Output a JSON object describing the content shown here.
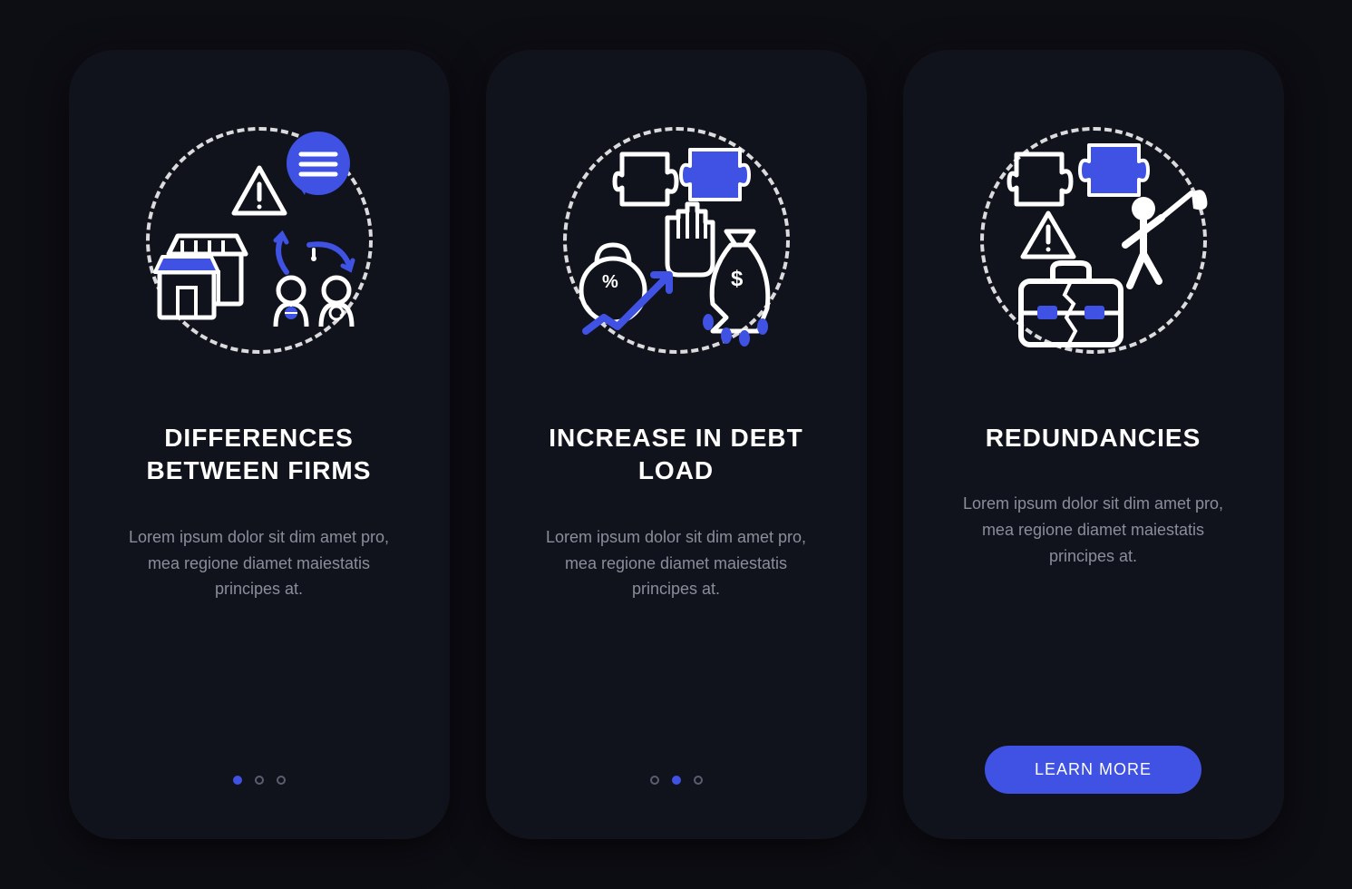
{
  "colors": {
    "accent": "#3f52e3",
    "background": "#0d0d14",
    "card": "#11131c",
    "text_primary": "#ffffff",
    "text_secondary": "#8a8e9a"
  },
  "cards": [
    {
      "icon_name": "firms-difference-icon",
      "heading": "DIFFERENCES BETWEEN FIRMS",
      "body": "Lorem ipsum dolor sit dim amet pro, mea regione diamet maiestatis principes at.",
      "footer_type": "dots",
      "active_dot": 0
    },
    {
      "icon_name": "debt-load-icon",
      "heading": "INCREASE IN DEBT LOAD",
      "body": "Lorem ipsum dolor sit dim amet pro, mea regione diamet maiestatis principes at.",
      "footer_type": "dots",
      "active_dot": 1
    },
    {
      "icon_name": "redundancies-icon",
      "heading": "REDUNDANCIES",
      "body": "Lorem ipsum dolor sit dim amet pro, mea regione diamet maiestatis principes at.",
      "footer_type": "button",
      "button_label": "LEARN MORE"
    }
  ],
  "dots_total": 3
}
